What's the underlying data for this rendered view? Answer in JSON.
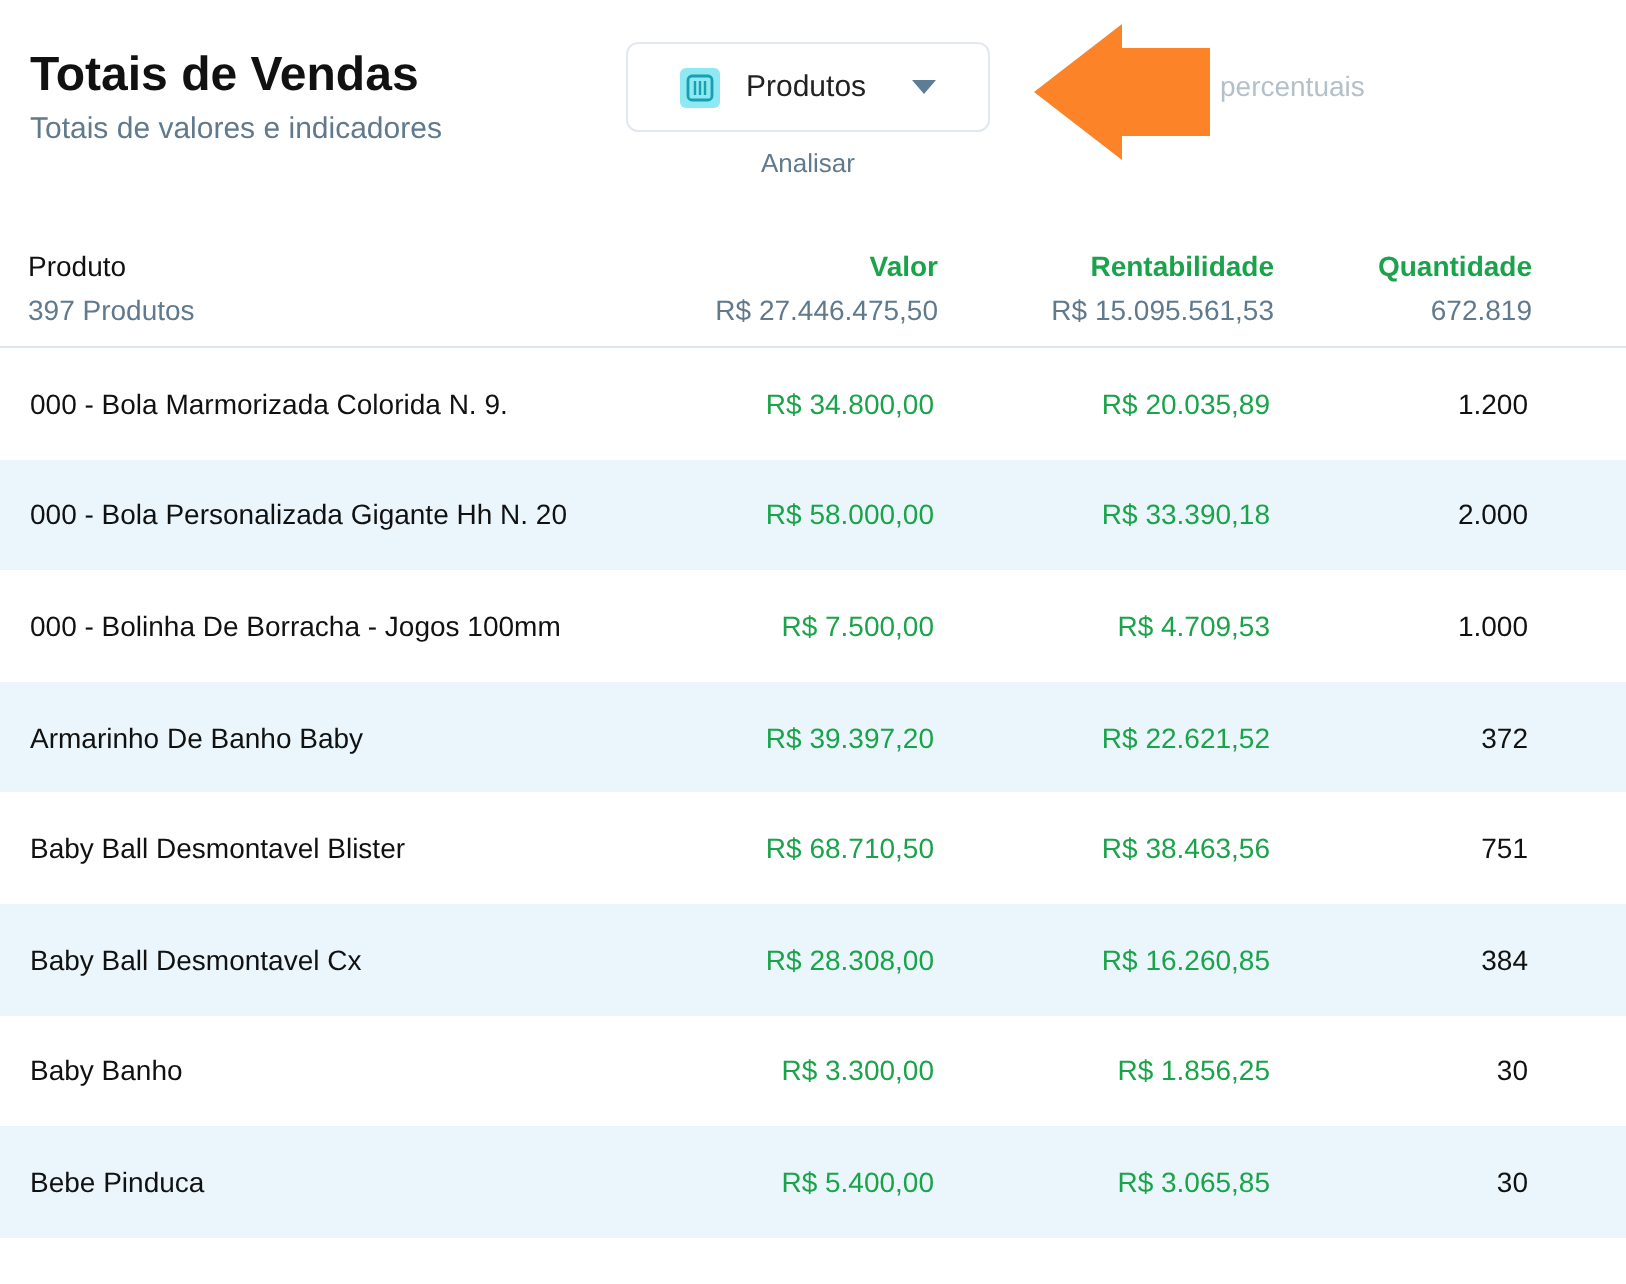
{
  "header": {
    "title": "Totais de Vendas",
    "subtitle": "Totais de valores e indicadores"
  },
  "selector": {
    "value": "Produtos",
    "caption": "Analisar"
  },
  "hint_text": "percentuais",
  "table": {
    "columns": [
      {
        "label": "Produto",
        "total": "397 Produtos"
      },
      {
        "label": "Valor",
        "total": "R$ 27.446.475,50"
      },
      {
        "label": "Rentabilidade",
        "total": "R$ 15.095.561,53"
      },
      {
        "label": "Quantidade",
        "total": "672.819"
      }
    ],
    "rows": [
      {
        "cells": [
          "000 - Bola Marmorizada Colorida N. 9.",
          "R$ 34.800,00",
          "R$ 20.035,89",
          "1.200"
        ]
      },
      {
        "cells": [
          "000 - Bola Personalizada Gigante Hh N. 20",
          "R$ 58.000,00",
          "R$ 33.390,18",
          "2.000"
        ]
      },
      {
        "cells": [
          "000 - Bolinha De Borracha - Jogos 100mm",
          "R$ 7.500,00",
          "R$ 4.709,53",
          "1.000"
        ]
      },
      {
        "cells": [
          "Armarinho De Banho Baby",
          "R$ 39.397,20",
          "R$ 22.621,52",
          "372"
        ]
      },
      {
        "cells": [
          "Baby Ball Desmontavel Blister",
          "R$ 68.710,50",
          "R$ 38.463,56",
          "751"
        ]
      },
      {
        "cells": [
          "Baby Ball Desmontavel Cx",
          "R$ 28.308,00",
          "R$ 16.260,85",
          "384"
        ]
      },
      {
        "cells": [
          "Baby Banho",
          "R$ 3.300,00",
          "R$ 1.856,25",
          "30"
        ]
      },
      {
        "cells": [
          "Bebe Pinduca",
          "R$ 5.400,00",
          "R$ 3.065,85",
          "30"
        ]
      }
    ]
  }
}
